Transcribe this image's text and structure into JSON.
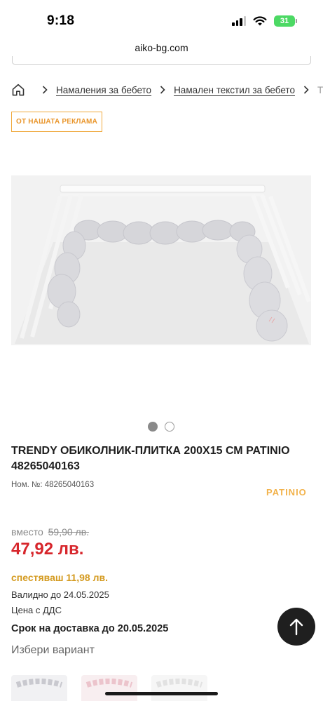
{
  "status_bar": {
    "time": "9:18",
    "battery": "31"
  },
  "browser": {
    "url": "aiko-bg.com"
  },
  "breadcrumb": {
    "items": [
      "Намаления за бебето",
      "Намален текстил за бебето"
    ],
    "truncated": "Т"
  },
  "ad_badge": "ОТ НАШАТА РЕКЛАМА",
  "gallery": {
    "total": 2,
    "active": 1
  },
  "product": {
    "title": "TRENDY ОБИКОЛНИК-ПЛИТКА 200Х15 СМ PATINIO 48265040163",
    "sku_label": "Ном. №:",
    "sku": "48265040163",
    "brand": "PATINIO"
  },
  "pricing": {
    "instead_label": "вместо",
    "old_price": "59,90 лв.",
    "price": "47,92 лв.",
    "savings": "спестяваш 11,98 лв.",
    "valid_until": "Валидно до 24.05.2025",
    "vat_note": "Цена с ДДС",
    "delivery": "Срок на доставка до 20.05.2025"
  },
  "variants": {
    "label": "Избери вариант",
    "items": [
      {
        "color": "grey-icon"
      },
      {
        "color": "pink-icon"
      },
      {
        "color": "white-icon"
      }
    ]
  },
  "colors": {
    "price_red": "#d7262c",
    "savings_gold": "#d49a1f",
    "ad_orange": "#e9952a",
    "brand_gold": "#f2b24a",
    "battery_green": "#4cd964"
  },
  "icons": {
    "home": "home-icon",
    "separator": "chevron-right-icon",
    "scroll_top": "arrow-up-icon"
  }
}
